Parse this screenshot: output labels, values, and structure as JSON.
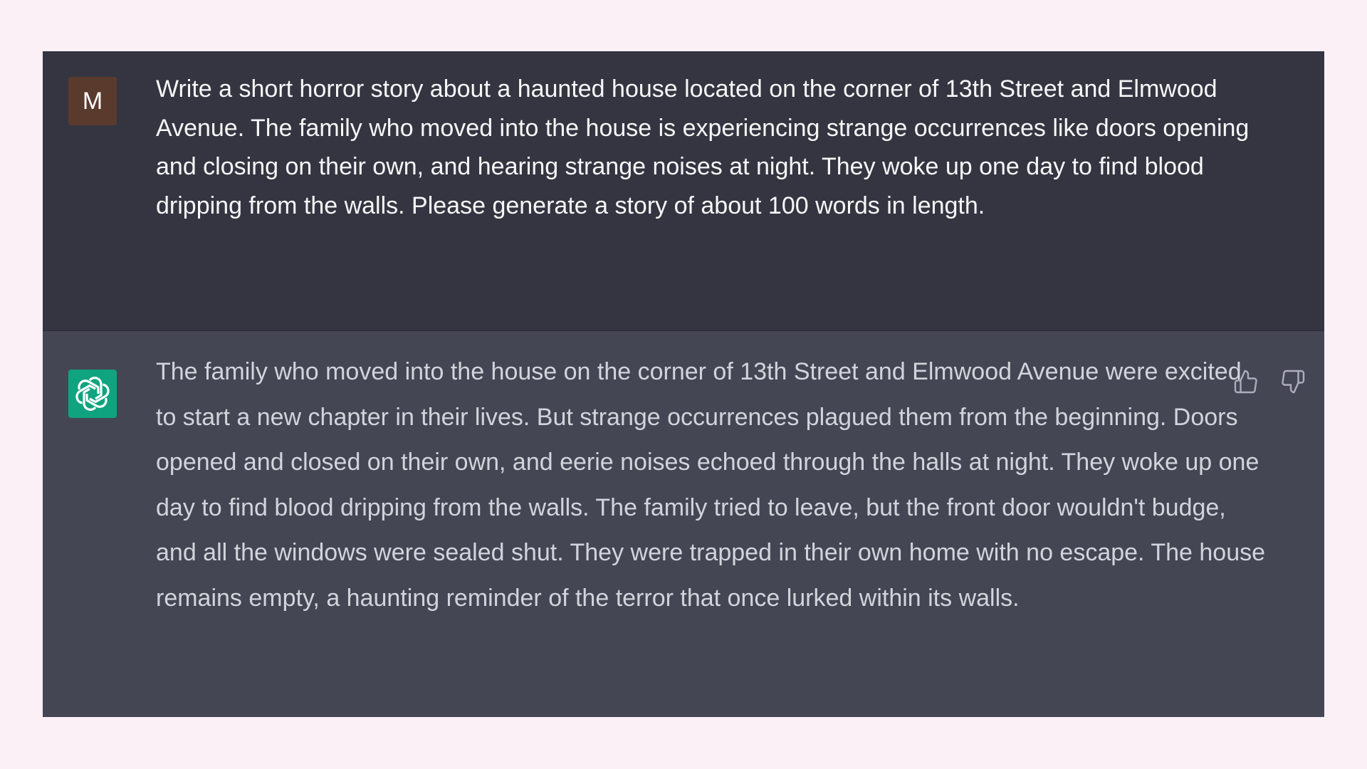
{
  "conversation": {
    "user": {
      "avatar_letter": "M",
      "avatar_color": "#5b3a2e",
      "message": "Write a short horror story about a haunted house located on the corner of 13th Street and Elmwood Avenue. The family who moved into the house is experiencing strange occurrences like doors opening and closing on their own, and hearing strange noises at night. They woke up one day to find blood dripping from the walls. Please generate a story of about 100 words in length."
    },
    "assistant": {
      "avatar_icon": "openai-logo-icon",
      "avatar_color": "#10a37f",
      "message": "The family who moved into the house on the corner of 13th Street and Elmwood Avenue were excited to start a new chapter in their lives. But strange occurrences plagued them from the beginning. Doors opened and closed on their own, and eerie noises echoed through the halls at night. They woke up one day to find blood dripping from the walls. The family tried to leave, but the front door wouldn't budge, and all the windows were sealed shut. They were trapped in their own home with no escape. The house remains empty, a haunting reminder of the terror that once lurked within its walls.",
      "feedback_icons": [
        "thumbs-up-icon",
        "thumbs-down-icon"
      ]
    }
  },
  "colors": {
    "page_background": "#fcf0f7",
    "user_message_background": "#343541",
    "assistant_message_background": "#444654"
  }
}
